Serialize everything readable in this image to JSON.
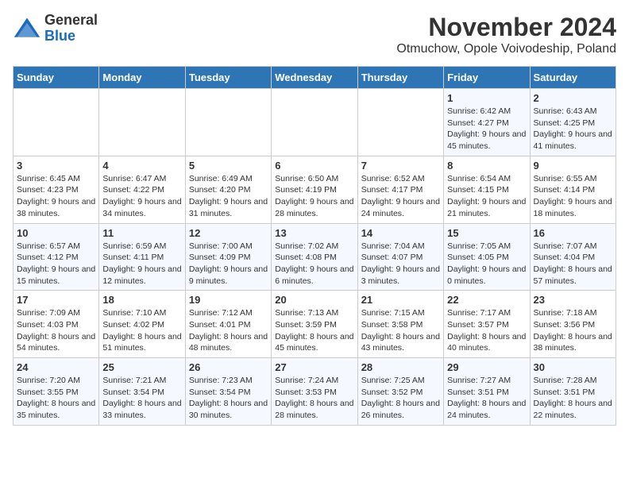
{
  "logo": {
    "general": "General",
    "blue": "Blue"
  },
  "title": {
    "month": "November 2024",
    "location": "Otmuchow, Opole Voivodeship, Poland"
  },
  "headers": [
    "Sunday",
    "Monday",
    "Tuesday",
    "Wednesday",
    "Thursday",
    "Friday",
    "Saturday"
  ],
  "weeks": [
    [
      {
        "day": "",
        "info": ""
      },
      {
        "day": "",
        "info": ""
      },
      {
        "day": "",
        "info": ""
      },
      {
        "day": "",
        "info": ""
      },
      {
        "day": "",
        "info": ""
      },
      {
        "day": "1",
        "info": "Sunrise: 6:42 AM\nSunset: 4:27 PM\nDaylight: 9 hours and 45 minutes."
      },
      {
        "day": "2",
        "info": "Sunrise: 6:43 AM\nSunset: 4:25 PM\nDaylight: 9 hours and 41 minutes."
      }
    ],
    [
      {
        "day": "3",
        "info": "Sunrise: 6:45 AM\nSunset: 4:23 PM\nDaylight: 9 hours and 38 minutes."
      },
      {
        "day": "4",
        "info": "Sunrise: 6:47 AM\nSunset: 4:22 PM\nDaylight: 9 hours and 34 minutes."
      },
      {
        "day": "5",
        "info": "Sunrise: 6:49 AM\nSunset: 4:20 PM\nDaylight: 9 hours and 31 minutes."
      },
      {
        "day": "6",
        "info": "Sunrise: 6:50 AM\nSunset: 4:19 PM\nDaylight: 9 hours and 28 minutes."
      },
      {
        "day": "7",
        "info": "Sunrise: 6:52 AM\nSunset: 4:17 PM\nDaylight: 9 hours and 24 minutes."
      },
      {
        "day": "8",
        "info": "Sunrise: 6:54 AM\nSunset: 4:15 PM\nDaylight: 9 hours and 21 minutes."
      },
      {
        "day": "9",
        "info": "Sunrise: 6:55 AM\nSunset: 4:14 PM\nDaylight: 9 hours and 18 minutes."
      }
    ],
    [
      {
        "day": "10",
        "info": "Sunrise: 6:57 AM\nSunset: 4:12 PM\nDaylight: 9 hours and 15 minutes."
      },
      {
        "day": "11",
        "info": "Sunrise: 6:59 AM\nSunset: 4:11 PM\nDaylight: 9 hours and 12 minutes."
      },
      {
        "day": "12",
        "info": "Sunrise: 7:00 AM\nSunset: 4:09 PM\nDaylight: 9 hours and 9 minutes."
      },
      {
        "day": "13",
        "info": "Sunrise: 7:02 AM\nSunset: 4:08 PM\nDaylight: 9 hours and 6 minutes."
      },
      {
        "day": "14",
        "info": "Sunrise: 7:04 AM\nSunset: 4:07 PM\nDaylight: 9 hours and 3 minutes."
      },
      {
        "day": "15",
        "info": "Sunrise: 7:05 AM\nSunset: 4:05 PM\nDaylight: 9 hours and 0 minutes."
      },
      {
        "day": "16",
        "info": "Sunrise: 7:07 AM\nSunset: 4:04 PM\nDaylight: 8 hours and 57 minutes."
      }
    ],
    [
      {
        "day": "17",
        "info": "Sunrise: 7:09 AM\nSunset: 4:03 PM\nDaylight: 8 hours and 54 minutes."
      },
      {
        "day": "18",
        "info": "Sunrise: 7:10 AM\nSunset: 4:02 PM\nDaylight: 8 hours and 51 minutes."
      },
      {
        "day": "19",
        "info": "Sunrise: 7:12 AM\nSunset: 4:01 PM\nDaylight: 8 hours and 48 minutes."
      },
      {
        "day": "20",
        "info": "Sunrise: 7:13 AM\nSunset: 3:59 PM\nDaylight: 8 hours and 45 minutes."
      },
      {
        "day": "21",
        "info": "Sunrise: 7:15 AM\nSunset: 3:58 PM\nDaylight: 8 hours and 43 minutes."
      },
      {
        "day": "22",
        "info": "Sunrise: 7:17 AM\nSunset: 3:57 PM\nDaylight: 8 hours and 40 minutes."
      },
      {
        "day": "23",
        "info": "Sunrise: 7:18 AM\nSunset: 3:56 PM\nDaylight: 8 hours and 38 minutes."
      }
    ],
    [
      {
        "day": "24",
        "info": "Sunrise: 7:20 AM\nSunset: 3:55 PM\nDaylight: 8 hours and 35 minutes."
      },
      {
        "day": "25",
        "info": "Sunrise: 7:21 AM\nSunset: 3:54 PM\nDaylight: 8 hours and 33 minutes."
      },
      {
        "day": "26",
        "info": "Sunrise: 7:23 AM\nSunset: 3:54 PM\nDaylight: 8 hours and 30 minutes."
      },
      {
        "day": "27",
        "info": "Sunrise: 7:24 AM\nSunset: 3:53 PM\nDaylight: 8 hours and 28 minutes."
      },
      {
        "day": "28",
        "info": "Sunrise: 7:25 AM\nSunset: 3:52 PM\nDaylight: 8 hours and 26 minutes."
      },
      {
        "day": "29",
        "info": "Sunrise: 7:27 AM\nSunset: 3:51 PM\nDaylight: 8 hours and 24 minutes."
      },
      {
        "day": "30",
        "info": "Sunrise: 7:28 AM\nSunset: 3:51 PM\nDaylight: 8 hours and 22 minutes."
      }
    ]
  ]
}
